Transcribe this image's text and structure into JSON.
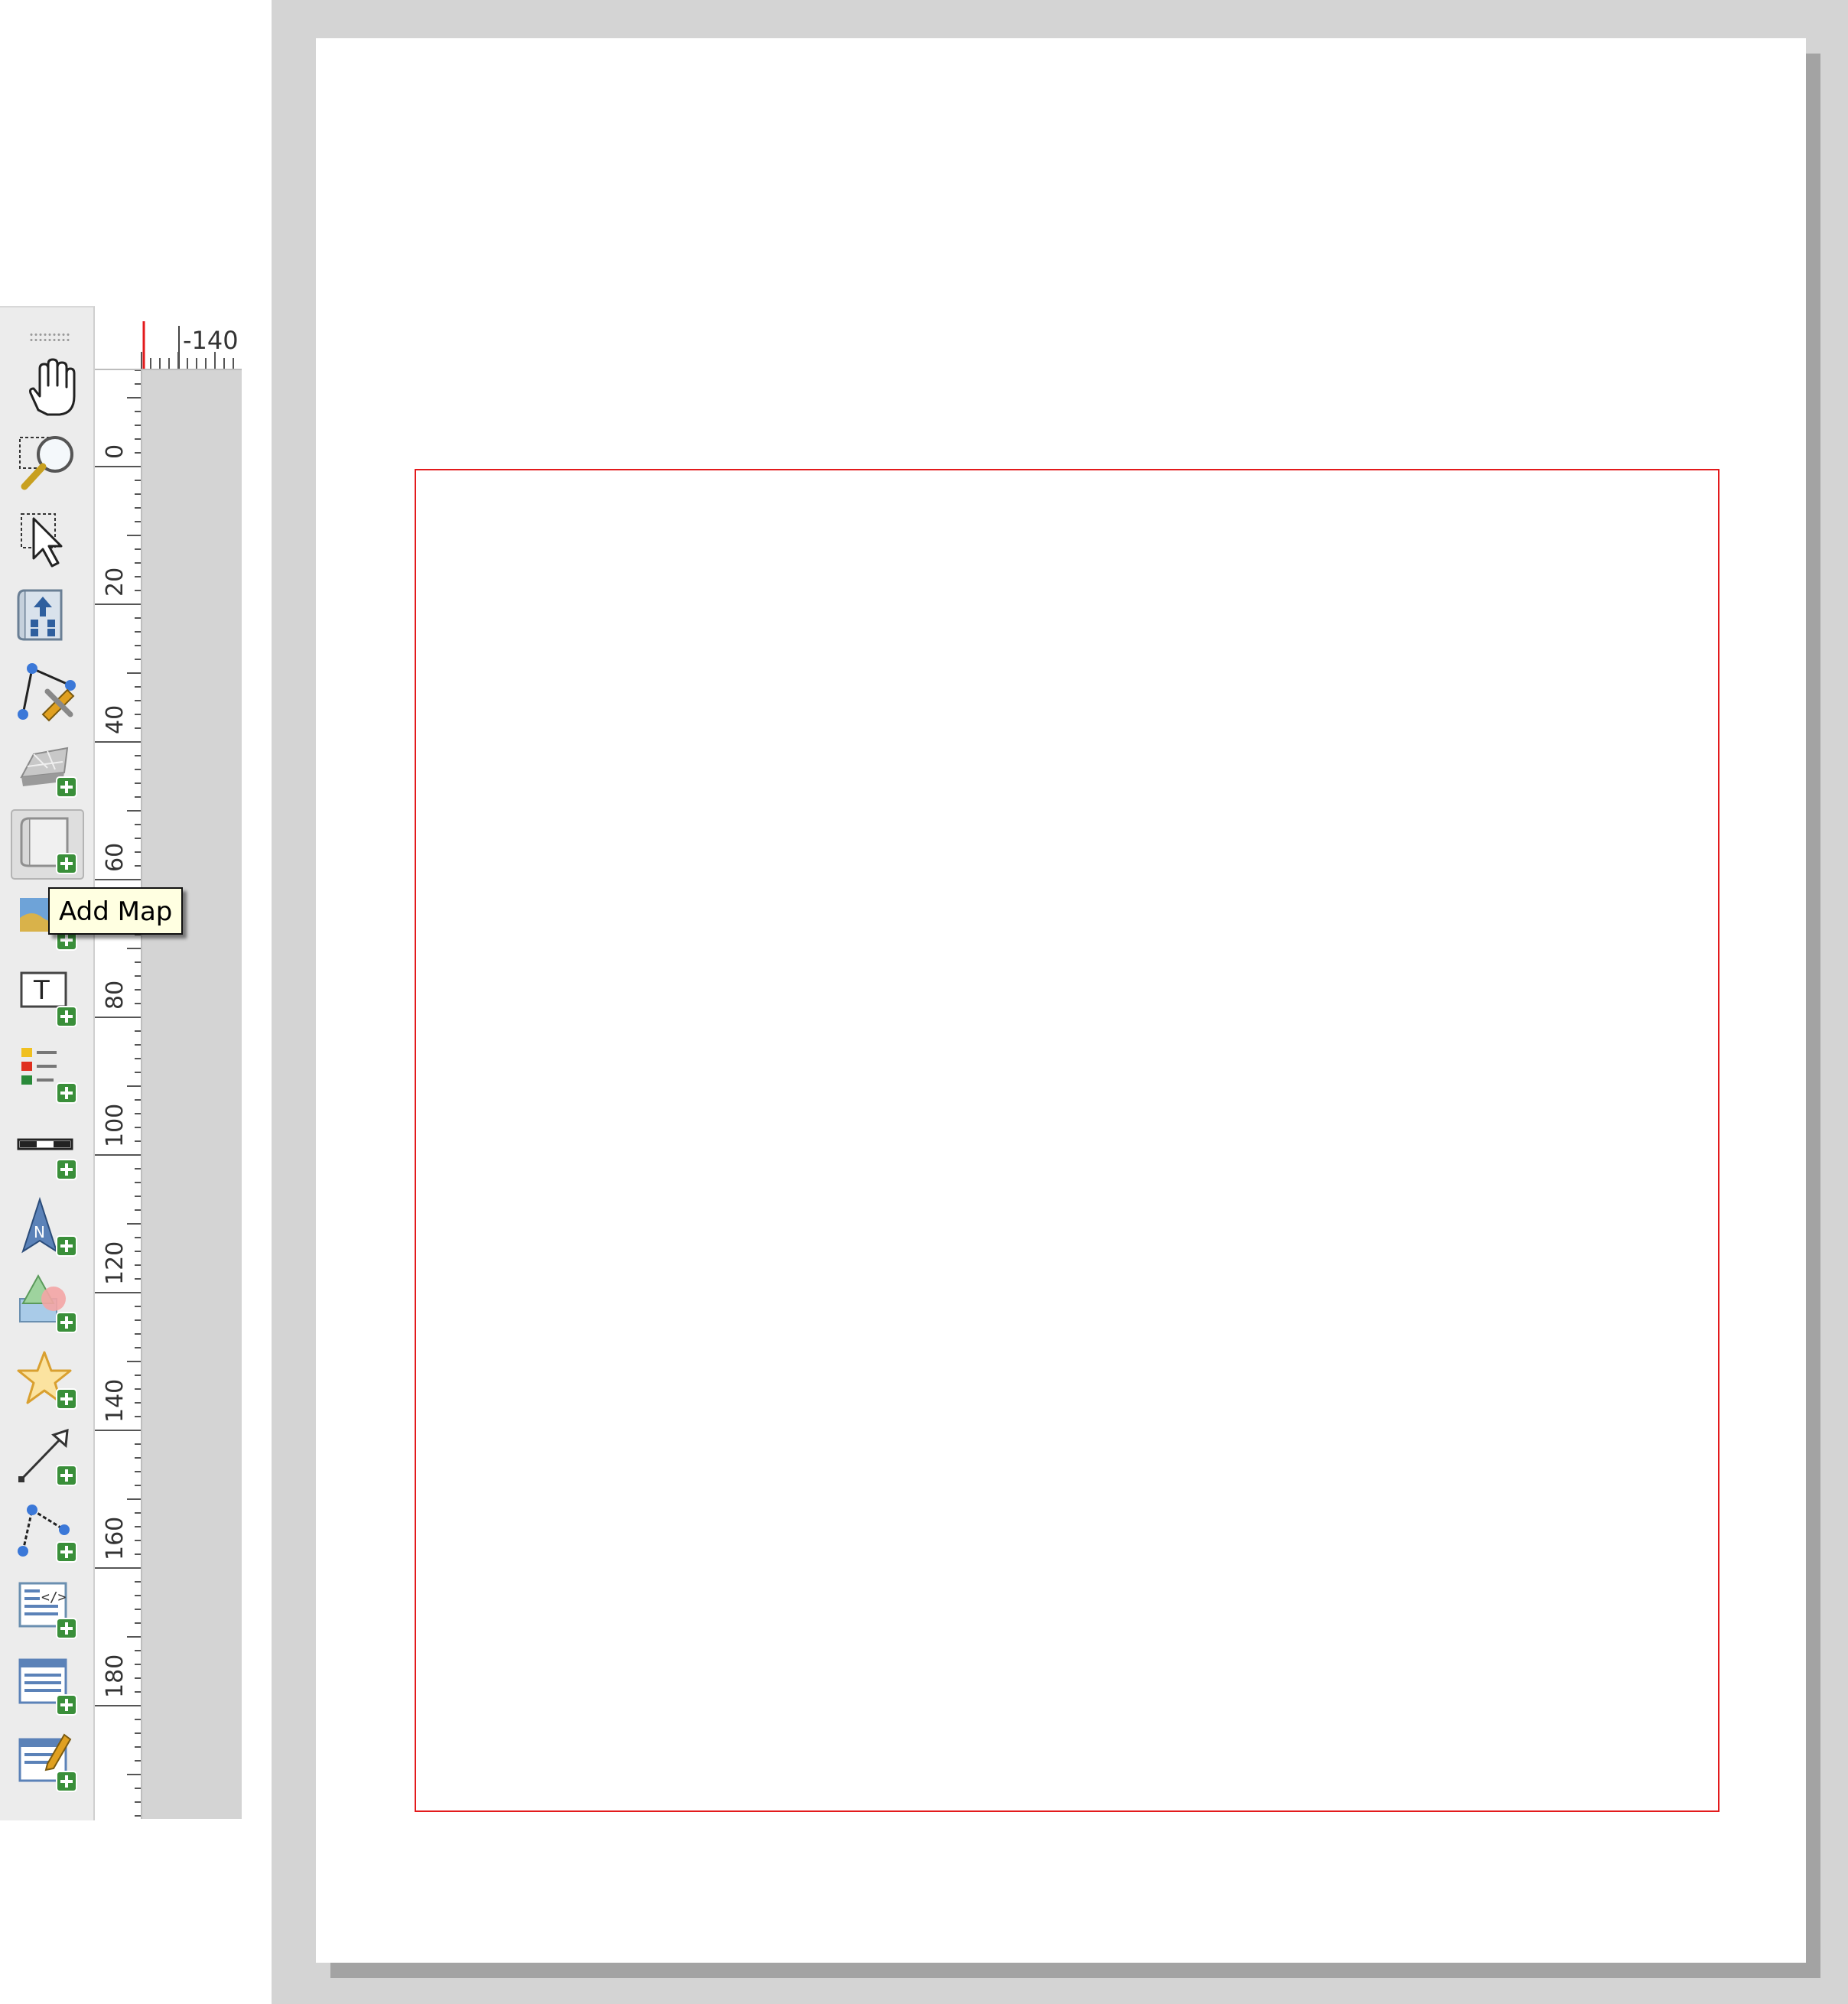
{
  "toolbar": {
    "tools": [
      {
        "name": "pan-layout-tool",
        "icon": "hand-icon"
      },
      {
        "name": "zoom-tool",
        "icon": "zoom-marquee-icon"
      },
      {
        "name": "select-move-item-tool",
        "icon": "select-arrow-icon"
      },
      {
        "name": "move-item-content-tool",
        "icon": "move-content-icon"
      },
      {
        "name": "edit-nodes-tool",
        "icon": "edit-nodes-icon"
      },
      {
        "name": "add-3d-map-tool",
        "icon": "3d-map-add-icon"
      },
      {
        "name": "add-map-tool",
        "icon": "map-add-icon",
        "active": true
      },
      {
        "name": "add-picture-tool",
        "icon": "picture-add-icon"
      },
      {
        "name": "add-label-tool",
        "icon": "label-add-icon"
      },
      {
        "name": "add-legend-tool",
        "icon": "legend-add-icon"
      },
      {
        "name": "add-scale-bar-tool",
        "icon": "scalebar-add-icon"
      },
      {
        "name": "add-north-arrow-tool",
        "icon": "north-arrow-add-icon"
      },
      {
        "name": "add-shape-tool",
        "icon": "shape-add-icon"
      },
      {
        "name": "add-marker-tool",
        "icon": "marker-star-add-icon"
      },
      {
        "name": "add-arrow-tool",
        "icon": "arrow-add-icon"
      },
      {
        "name": "add-node-item-tool",
        "icon": "node-item-add-icon"
      },
      {
        "name": "add-html-tool",
        "icon": "html-add-icon"
      },
      {
        "name": "add-attribute-table-tool",
        "icon": "table-add-icon"
      },
      {
        "name": "add-fixed-table-tool",
        "icon": "fixed-table-add-icon"
      }
    ]
  },
  "tooltip": {
    "text": "Add Map"
  },
  "rulers": {
    "horizontal_label": "-140",
    "vertical_labels": [
      "0",
      "20",
      "40",
      "60",
      "80",
      "100",
      "120",
      "140",
      "160",
      "180"
    ]
  },
  "colors": {
    "selection_frame": "#e31a1c",
    "ruler_marker": "#e31a1c",
    "canvas_background": "#d4d4d4",
    "page": "#ffffff",
    "tooltip_background": "#ffffe1",
    "add_badge": "#3a8f3a"
  }
}
